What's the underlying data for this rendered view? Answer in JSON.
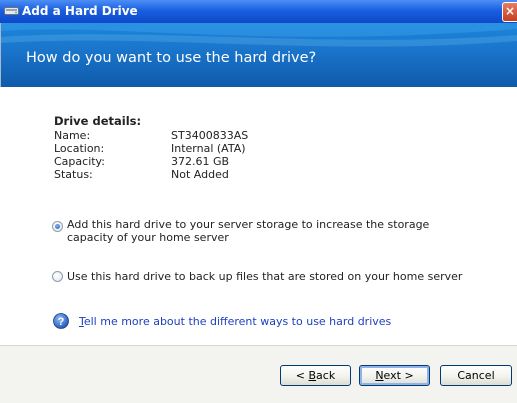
{
  "window": {
    "title": "Add a Hard Drive",
    "close_glyph": "×"
  },
  "header": {
    "question": "How do you want to use the hard drive?"
  },
  "drive_details": {
    "title": "Drive details:",
    "rows": [
      {
        "label": "Name:",
        "value": "ST3400833AS"
      },
      {
        "label": "Location:",
        "value": "Internal (ATA)"
      },
      {
        "label": "Capacity:",
        "value": "372.61 GB"
      },
      {
        "label": "Status:",
        "value": "Not Added"
      }
    ]
  },
  "options": [
    {
      "text": "Add this hard drive to your server storage to increase the storage capacity of your home server",
      "selected": true
    },
    {
      "text": "Use this hard drive to back up files that are stored on your home server",
      "selected": false
    }
  ],
  "help": {
    "link_text": "Tell me more about the different ways to use hard drives",
    "icon": "help-question-icon"
  },
  "buttons": {
    "back": {
      "prefix": "< ",
      "mnemonic": "B",
      "rest": "ack"
    },
    "next": {
      "mnemonic": "N",
      "rest": "ext >"
    },
    "cancel": "Cancel"
  },
  "colors": {
    "title_bar": "#1a5fe0",
    "header_band": "#1a76cc",
    "link": "#1b3fbf",
    "footer": "#f3f3f0"
  }
}
